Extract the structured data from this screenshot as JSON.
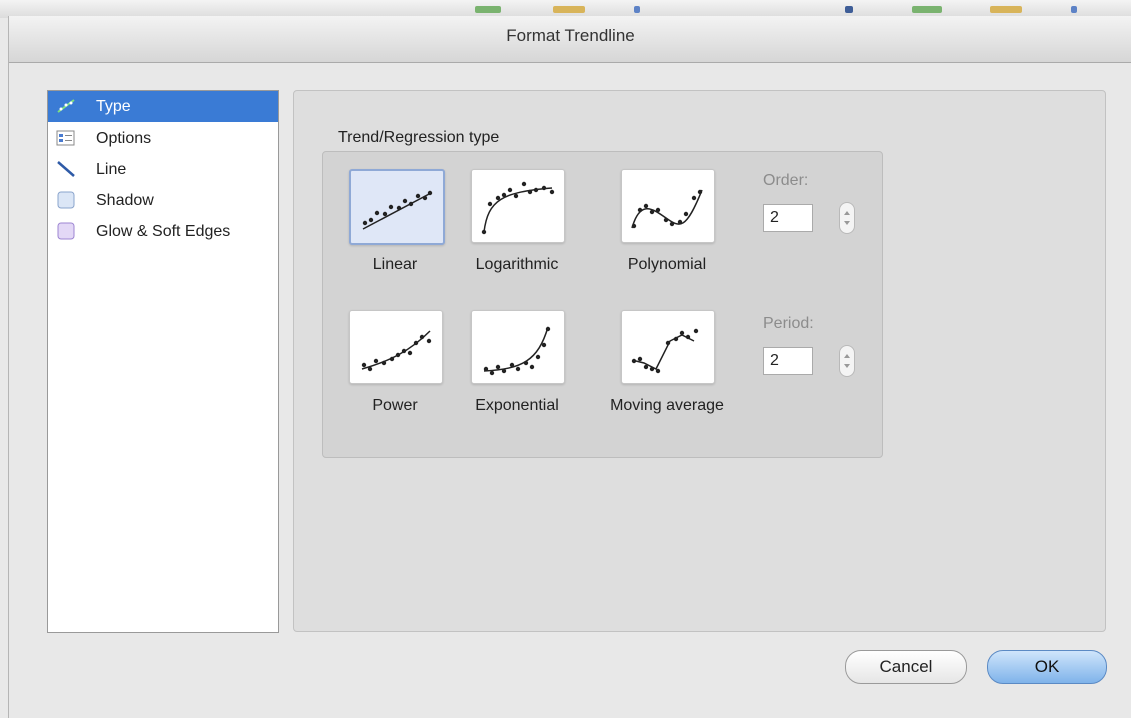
{
  "dialog": {
    "title": "Format Trendline"
  },
  "sidebar": {
    "items": [
      {
        "label": "Type",
        "icon": "trend-icon",
        "selected": true
      },
      {
        "label": "Options",
        "icon": "options-icon"
      },
      {
        "label": "Line",
        "icon": "line-icon"
      },
      {
        "label": "Shadow",
        "icon": "shadow-icon"
      },
      {
        "label": "Glow & Soft Edges",
        "icon": "glow-icon"
      }
    ]
  },
  "trend": {
    "group_label": "Trend/Regression type",
    "types": [
      {
        "label": "Linear",
        "selected": true
      },
      {
        "label": "Logarithmic"
      },
      {
        "label": "Polynomial"
      },
      {
        "label": "Power"
      },
      {
        "label": "Exponential"
      },
      {
        "label": "Moving average"
      }
    ],
    "order": {
      "label": "Order:",
      "value": "2"
    },
    "period": {
      "label": "Period:",
      "value": "2"
    }
  },
  "buttons": {
    "cancel": "Cancel",
    "ok": "OK"
  },
  "colors": {
    "accent": "#3a7bd5",
    "ok_button": "#7fb3ea",
    "selected_type": "#dfe7f7"
  }
}
